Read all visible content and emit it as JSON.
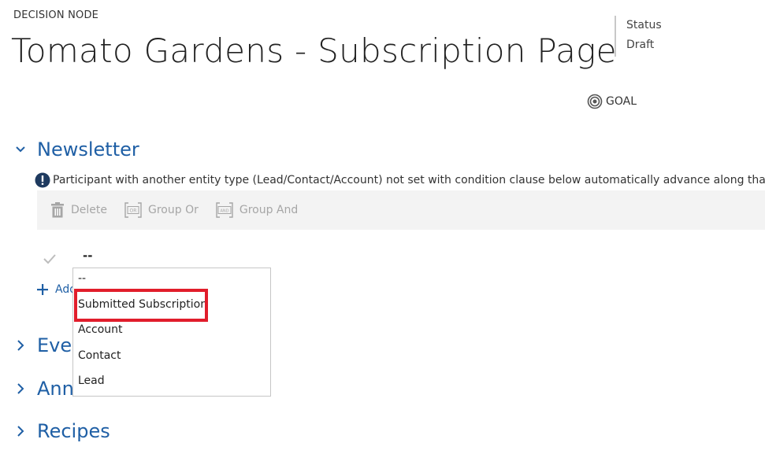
{
  "header": {
    "eyebrow": "DECISION NODE",
    "title": "Tomato Gardens - Subscription Page",
    "status_label": "Status",
    "status_value": "Draft",
    "goal_label": "GOAL"
  },
  "sections": [
    {
      "title": "Newsletter",
      "expanded": true
    },
    {
      "title": "Ever",
      "expanded": false
    },
    {
      "title": "Ann",
      "expanded": false
    },
    {
      "title": "Recipes",
      "expanded": false
    }
  ],
  "notice": "Participant with another entity type (Lead/Contact/Account) not set with condition clause below automatically advance along that path.",
  "toolbar": {
    "delete_label": "Delete",
    "group_or_label": "Group Or",
    "group_and_label": "Group And",
    "or_badge": "OR",
    "and_badge": "AND"
  },
  "condition": {
    "value": "--",
    "add_label": "Add"
  },
  "dropdown": {
    "options": [
      "--",
      "Submitted Subscription",
      "Account",
      "Contact",
      "Lead"
    ],
    "highlighted": "Submitted Subscription"
  },
  "colors": {
    "accent": "#1f5fa5",
    "highlight_border": "#e11d2b",
    "toolbar_bg": "#f3f3f3",
    "disabled_text": "#a6a6a6",
    "notice_icon": "#1e3a5f"
  }
}
